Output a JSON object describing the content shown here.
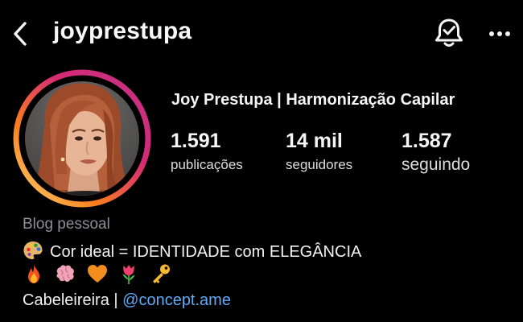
{
  "header": {
    "username": "joyprestupa",
    "back_icon": "chevron-left-icon",
    "notification_icon": "bell-check-icon",
    "more_icon": "more-horizontal-icon"
  },
  "profile": {
    "display_name": "Joy Prestupa | Harmonização Capilar",
    "avatar_icon": "profile-photo",
    "story_ring_colors": [
      "#feda75",
      "#fa7e1e",
      "#d62976",
      "#962fbf"
    ]
  },
  "stats": [
    {
      "value": "1.591",
      "label": "publicações"
    },
    {
      "value": "14 mil",
      "label": "seguidores"
    },
    {
      "value": "1.587",
      "label": "seguindo"
    }
  ],
  "bio": {
    "category": "Blog pessoal",
    "line1_emoji": "palette-icon",
    "line1_text": "Cor ideal = IDENTIDADE com ELEGÂNCIA",
    "emojis": [
      "fire-icon",
      "brain-icon",
      "orange-heart-icon",
      "tulip-icon",
      "key-icon"
    ],
    "line3_prefix": "Cabeleireira | ",
    "mention": "@concept.ame"
  },
  "colors": {
    "background": "#000000",
    "text": "#f5f5f5",
    "muted": "#8e8e93",
    "link": "#5fa9f5"
  }
}
